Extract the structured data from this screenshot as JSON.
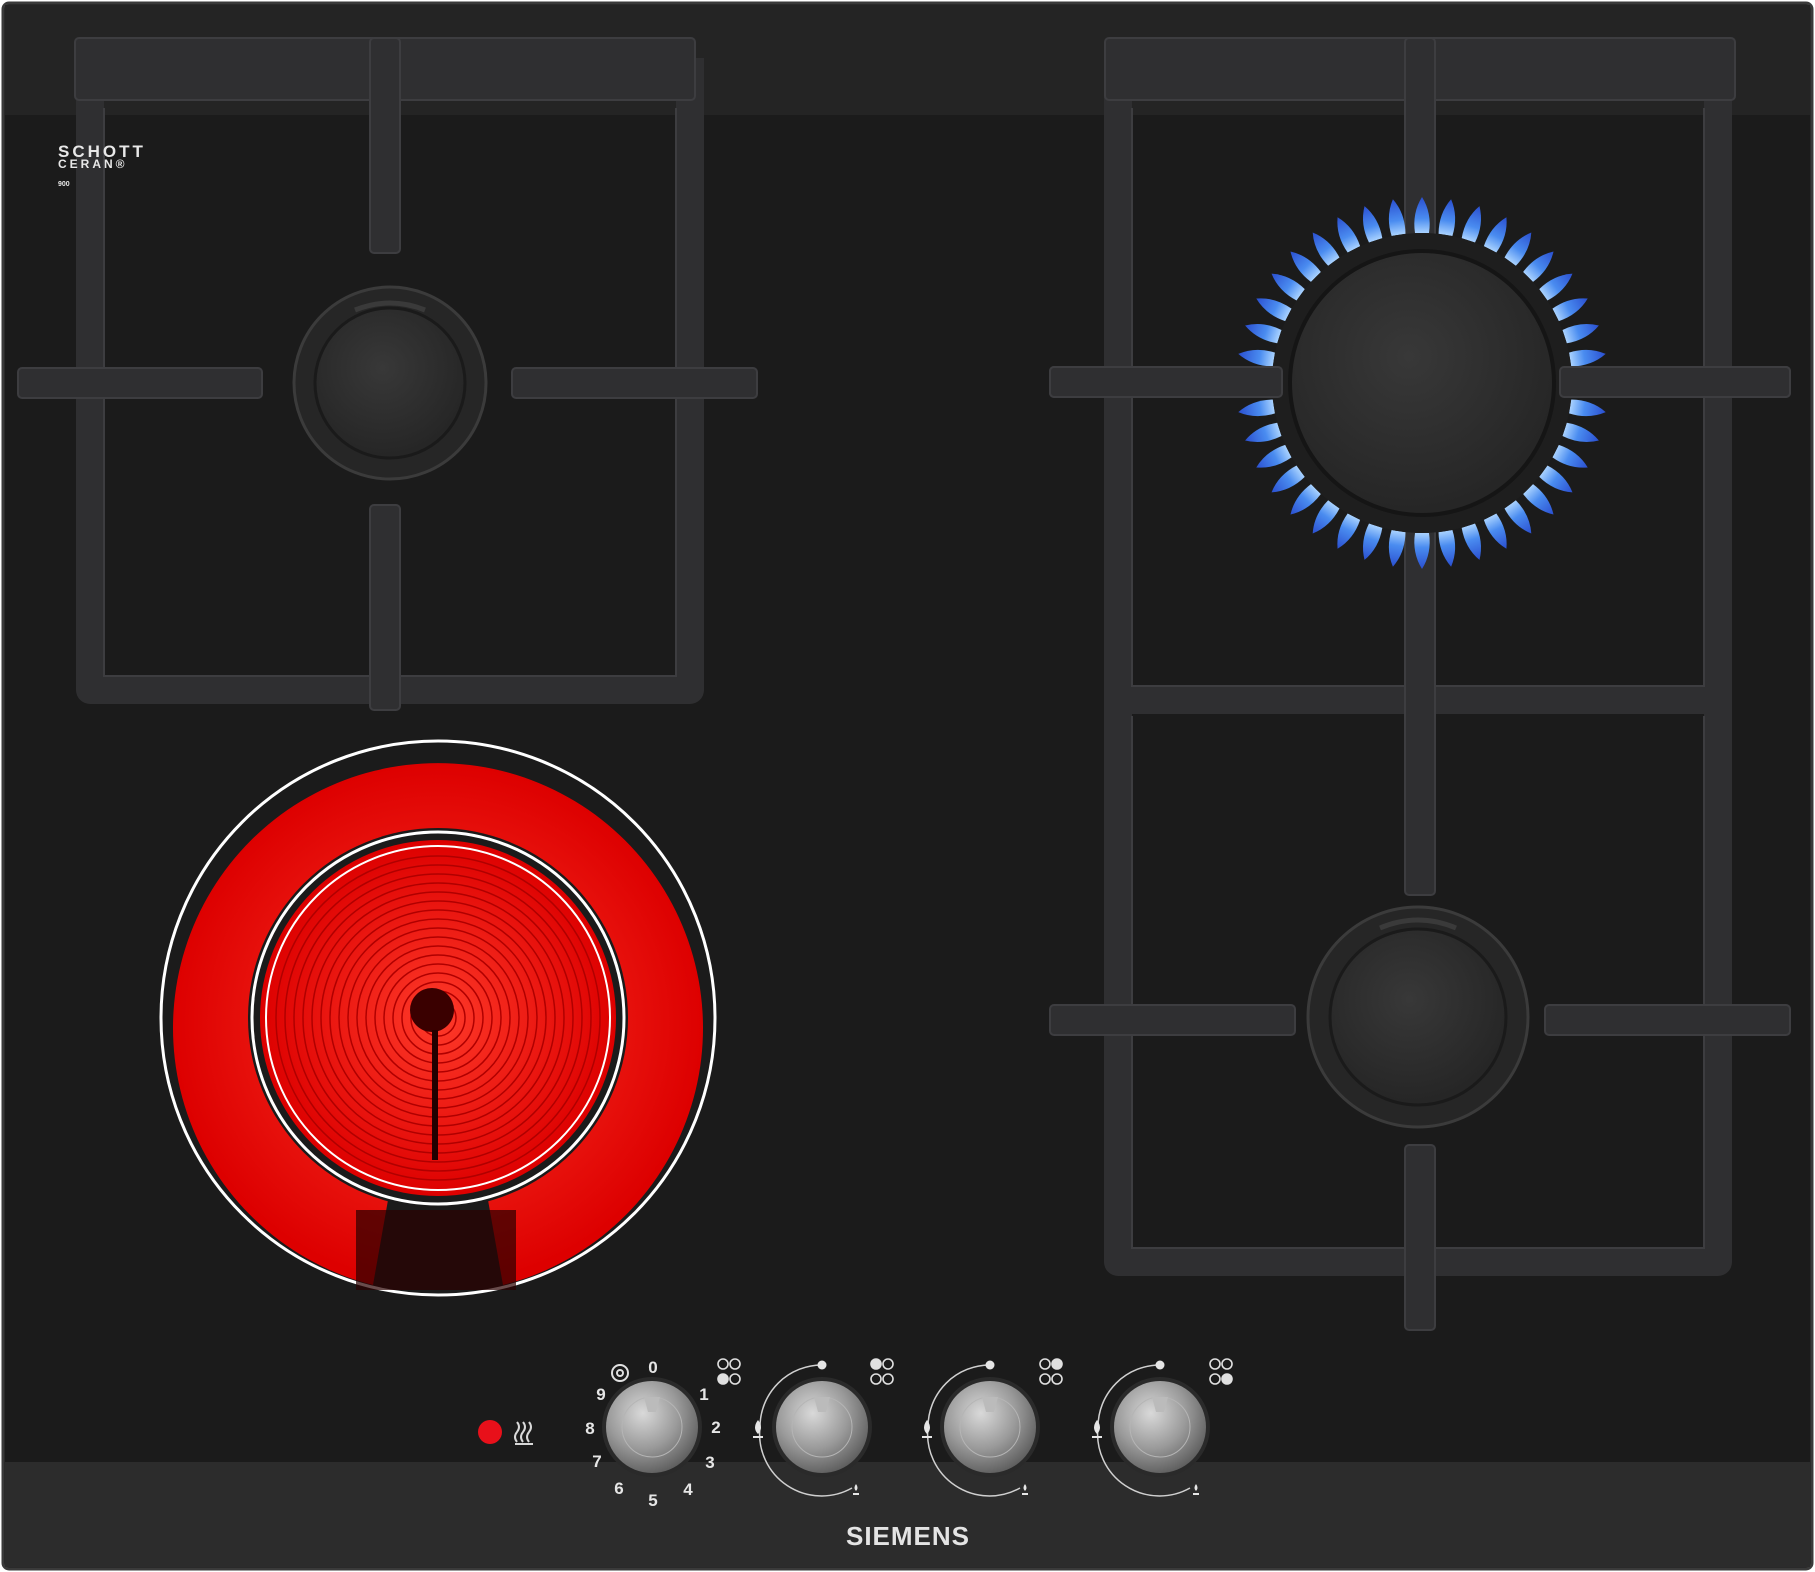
{
  "brand": {
    "name": "SIEMENS"
  },
  "glass_mark": {
    "line1": "SCHOTT",
    "line2": "CERAN®",
    "line3": "900"
  },
  "knob_dial_numbers": [
    "0",
    "1",
    "2",
    "3",
    "4",
    "5",
    "6",
    "7",
    "8",
    "9"
  ],
  "knobs": [
    {
      "type": "electric",
      "setting": "0"
    },
    {
      "type": "gas",
      "setting": "off"
    },
    {
      "type": "gas",
      "setting": "off"
    },
    {
      "type": "gas",
      "setting": "off"
    }
  ],
  "burners": [
    {
      "zone": "rear-left",
      "kind": "gas",
      "lit": false
    },
    {
      "zone": "front-left",
      "kind": "radiant",
      "lit": true
    },
    {
      "zone": "rear-right",
      "kind": "gas-wok",
      "lit": true
    },
    {
      "zone": "front-right",
      "kind": "gas",
      "lit": false
    }
  ],
  "indicator": {
    "residual_heat_icon": "heat-waves-icon"
  },
  "colors": {
    "glass": "#1b1b1b",
    "grate": "#2f2f31",
    "radiant": "#ee1111",
    "flame": "#3a78e0",
    "indicator": "#e8101a",
    "brand_text": "#e4e4e4"
  }
}
